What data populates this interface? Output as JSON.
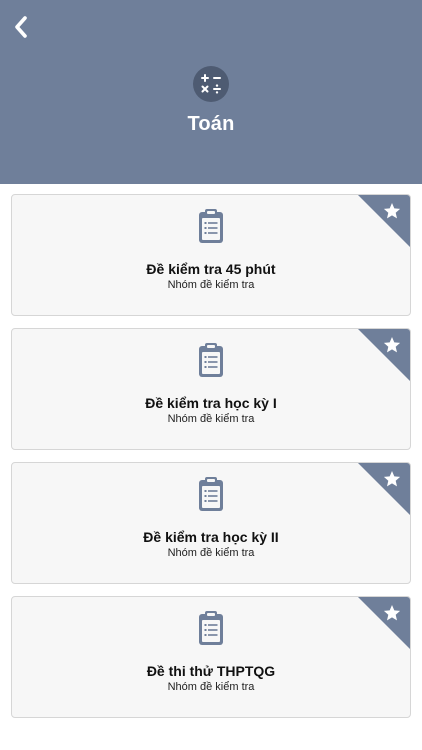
{
  "header": {
    "title": "Toán",
    "colors": {
      "background": "#6f7f9a",
      "icon_circle": "#4e5b72",
      "title_text": "#ffffff"
    },
    "icons": {
      "back": "chevron-left-icon",
      "subject": "calculator-operators-icon"
    }
  },
  "cards": [
    {
      "title": "Đề kiểm tra 45 phút",
      "subtitle": "Nhóm đề kiểm tra",
      "icon": "clipboard-list-icon",
      "corner_icon": "star-icon"
    },
    {
      "title": "Đề kiểm tra học kỳ I",
      "subtitle": "Nhóm đề kiểm tra",
      "icon": "clipboard-list-icon",
      "corner_icon": "star-icon"
    },
    {
      "title": "Đề kiểm tra học kỳ II",
      "subtitle": "Nhóm đề kiểm tra",
      "icon": "clipboard-list-icon",
      "corner_icon": "star-icon"
    },
    {
      "title": "Đề thi thử THPTQG",
      "subtitle": "Nhóm đề kiểm tra",
      "icon": "clipboard-list-icon",
      "corner_icon": "star-icon"
    }
  ],
  "colors": {
    "card_background": "#f7f7f7",
    "card_border": "#d6d6d6",
    "accent": "#6f7f9a"
  }
}
